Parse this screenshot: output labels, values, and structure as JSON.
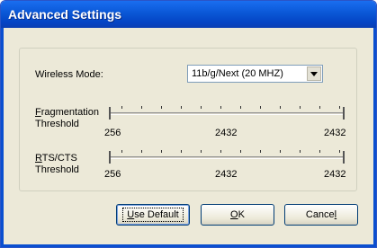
{
  "window": {
    "title": "Advanced Settings"
  },
  "wireless_mode": {
    "label": "Wireless Mode:",
    "selected_value": "11b/g/Next (20 MHZ)"
  },
  "fragmentation": {
    "label_line1_mnemonic": "F",
    "label_line1_rest": "ragmentation",
    "label_line2": "Threshold",
    "min": "256",
    "current": "2432",
    "max": "2432"
  },
  "rts_cts": {
    "label_line1_mnemonic": "R",
    "label_line1_rest": "TS/CTS",
    "label_line2": "Threshold",
    "min": "256",
    "current": "2432",
    "max": "2432"
  },
  "buttons": {
    "use_default_mnemonic": "U",
    "use_default_rest": "se Default",
    "ok_mnemonic": "O",
    "ok_rest": "K",
    "cancel_pre": "Cance",
    "cancel_mnemonic": "l"
  },
  "icons": {
    "dropdown": "chevron-down-icon"
  },
  "colors": {
    "title_bar": "#0a57d6",
    "dialog_bg": "#ece9d8",
    "button_border": "#003c74"
  }
}
